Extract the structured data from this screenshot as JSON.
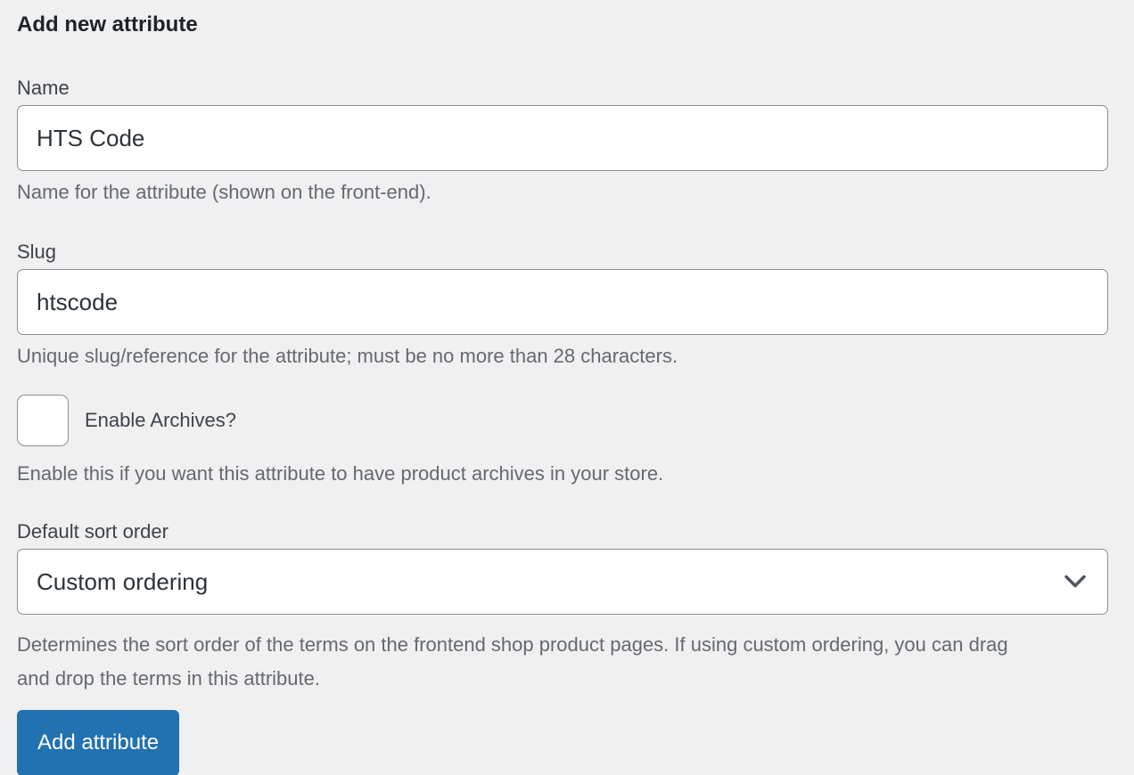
{
  "page": {
    "background_color": "#f0f0f1"
  },
  "form": {
    "title": "Add new attribute",
    "fields": {
      "name": {
        "label": "Name",
        "value": "HTS Code",
        "help": "Name for the attribute (shown on the front-end)."
      },
      "slug": {
        "label": "Slug",
        "value": "htscode",
        "help": "Unique slug/reference for the attribute; must be no more than 28 characters."
      },
      "archives": {
        "label": "Enable Archives?",
        "checked": false,
        "help": "Enable this if you want this attribute to have product archives in your store."
      },
      "sort_order": {
        "label": "Default sort order",
        "selected_option": "Custom ordering",
        "help": "Determines the sort order of the terms on the frontend shop product pages. If using custom ordering, you can drag and drop the terms in this attribute."
      }
    },
    "submit_label": "Add attribute",
    "colors": {
      "button": "#2271b1",
      "button_text": "#ffffff",
      "help_text": "#646970",
      "input_border": "#8c8f94",
      "label_text": "#3c434a",
      "title_text": "#1d2327"
    },
    "icons": {
      "select_chevron": "chevron-down"
    }
  }
}
